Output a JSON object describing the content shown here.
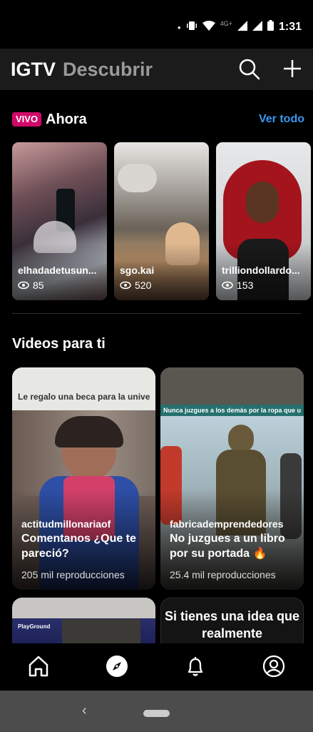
{
  "status_bar": {
    "network": "4G+",
    "time": "1:31"
  },
  "appbar": {
    "title": "IGTV",
    "subtitle": "Descubrir",
    "search_icon": "search-icon",
    "add_icon": "plus-icon"
  },
  "live": {
    "badge": "VIVO",
    "title": "Ahora",
    "see_all": "Ver todo",
    "cards": [
      {
        "username": "elhadadetusun...",
        "viewers": "85"
      },
      {
        "username": "sgo.kai",
        "viewers": "520"
      },
      {
        "username": "trilliondollardo...",
        "viewers": "153"
      }
    ]
  },
  "videos": {
    "title": "Videos para ti",
    "cards": [
      {
        "account": "actitudmillonariaof",
        "title": "Comentanos ¿Que te pareció?",
        "views": "205 mil reproducciones",
        "overlay_text": "Le regalo una beca para la universidad."
      },
      {
        "account": "fabricademprendedores",
        "title": "No juzgues a un libro por su portada 🔥",
        "views": "25.4 mil reproducciones",
        "overlay_text": "Nunca juzgues a los demás por la ropa que usan"
      }
    ],
    "partial_cards": [
      {
        "overlay_text": "PlayGround"
      },
      {
        "text": "Si tienes una idea que realmente"
      }
    ]
  },
  "tabbar": {
    "items": [
      "home-icon",
      "explore-icon",
      "notifications-icon",
      "profile-icon"
    ],
    "selected": "explore-icon"
  },
  "colors": {
    "live_badge": "#d10869",
    "link": "#3897f0",
    "appbar": "#1b1b1b"
  }
}
